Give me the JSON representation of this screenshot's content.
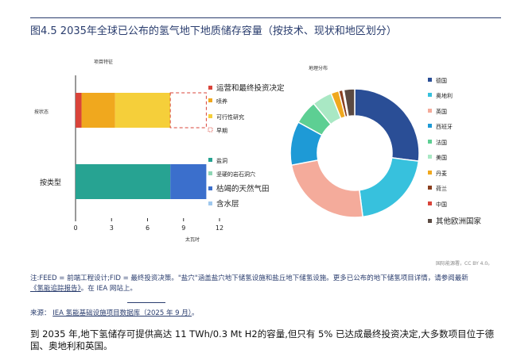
{
  "title": "图4.5 2035年全球已公布的氢气地下地质储存容量（按技术、现状和地区划分）",
  "chart_data": [
    {
      "type": "bar",
      "subtitle": "项目特征",
      "orientation": "horizontal",
      "stacked": true,
      "categories": [
        "按状态",
        "按类型"
      ],
      "xlabel": "太瓦时",
      "xlim": [
        0,
        12
      ],
      "xticks": [
        0,
        3,
        6,
        9,
        12
      ],
      "series": [
        {
          "name": "运营和最终投资决定",
          "category": "按状态",
          "value": 0.5,
          "color": "#d9443a"
        },
        {
          "name": "喷养",
          "category": "按状态",
          "value": 2.8,
          "color": "#f0a81e"
        },
        {
          "name": "可行性研究",
          "category": "按状态",
          "value": 4.6,
          "color": "#f5cf3a"
        },
        {
          "name": "早期",
          "category": "按状态",
          "value": 3.0,
          "color": "#ffffff",
          "dashed": true,
          "stroke": "#d9443a"
        },
        {
          "name": "盐洞",
          "category": "按类型",
          "value": 7.9,
          "color": "#27a392"
        },
        {
          "name": "坚硬的岩石洞穴",
          "category": "按类型",
          "value": 0.0,
          "color": "#8ed6b5"
        },
        {
          "name": "枯竭的天然气田",
          "category": "按类型",
          "value": 3.0,
          "color": "#3b6fcc"
        },
        {
          "name": "含水层",
          "category": "按类型",
          "value": 0.0,
          "color": "#9fc8ee"
        }
      ],
      "legend": [
        "运营和最终投资决定",
        "喷养",
        "可行性研究",
        "早期",
        "盐洞",
        "坚硬的岩石洞穴",
        "枯竭的天然气田",
        "含水层"
      ]
    },
    {
      "type": "pie",
      "donut": true,
      "subtitle": "地理分布",
      "slices": [
        {
          "name": "德国",
          "value": 27,
          "color": "#2a4e96"
        },
        {
          "name": "奥地利",
          "value": 21,
          "color": "#37c1dd"
        },
        {
          "name": "英国",
          "value": 24,
          "color": "#f4ab9b"
        },
        {
          "name": "西班牙",
          "value": 11,
          "color": "#1e9ad6"
        },
        {
          "name": "法国",
          "value": 6,
          "color": "#5dcf93"
        },
        {
          "name": "美国",
          "value": 5,
          "color": "#a9e8c4"
        },
        {
          "name": "丹麦",
          "value": 2,
          "color": "#f0a81e"
        },
        {
          "name": "荷兰",
          "value": 1,
          "color": "#8a3f1f"
        },
        {
          "name": "中国",
          "value": 0.3,
          "color": "#d9443a"
        },
        {
          "name": "其他欧洲国家",
          "value": 2.7,
          "color": "#5b4a42"
        }
      ],
      "legend_position": "right"
    }
  ],
  "credit": "国际能源署，CC BY 4.0。",
  "note": {
    "text": "注:FEED = 前端工程设计;FID = 最终投资决策。\"盐穴\"涵盖盐穴地下储氢设施和盐丘地下储氢设施。更多已公布的地下储氢项目详情，请参阅最新",
    "link": "《氢能追踪报告》",
    "suffix": "。在 IEA 网站上。"
  },
  "source": {
    "label": "来源：",
    "link": "IEA 氢能基础设施项目数据库（2025 年 9 月）",
    "suffix": "。"
  },
  "summary": "到 2035 年,地下氢储存可提供高达 11 TWh/0.3 Mt H2的容量,但只有 5% 已达成最终投资决定,大多数项目位于德国、奥地利和英国。"
}
